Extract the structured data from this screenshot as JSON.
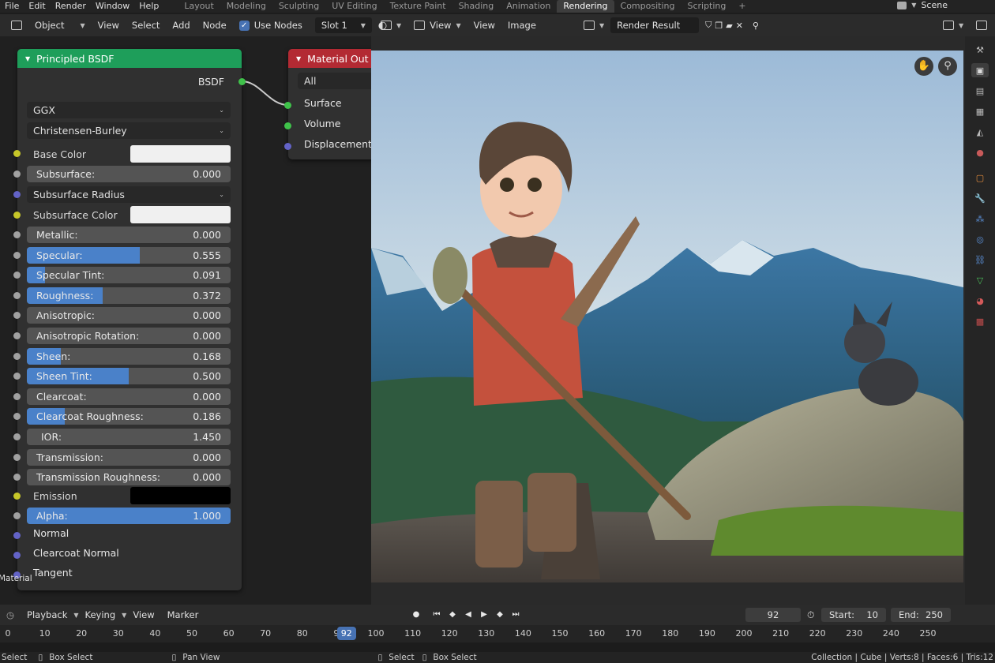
{
  "topbar": {
    "menu": [
      "File",
      "Edit",
      "Render",
      "Window",
      "Help"
    ],
    "workspaces": [
      "Layout",
      "Modeling",
      "Sculpting",
      "UV Editing",
      "Texture Paint",
      "Shading",
      "Animation",
      "Rendering",
      "Compositing",
      "Scripting",
      "+"
    ],
    "active_workspace": "Rendering",
    "scene": "Scene"
  },
  "node_header": {
    "mode": "Object",
    "menus": [
      "View",
      "Select",
      "Add",
      "Node"
    ],
    "use_nodes": "Use Nodes",
    "slot": "Slot 1"
  },
  "image_header": {
    "menus": [
      "View",
      "View",
      "Image"
    ],
    "image_name": "Render Result"
  },
  "bsdf_node": {
    "title": "Principled BSDF",
    "output": "BSDF",
    "distribution": "GGX",
    "subsurface_method": "Christensen-Burley",
    "base_color_label": "Base Color",
    "subsurface_label": "Subsurface:",
    "subsurface_value": "0.000",
    "subsurface_radius_label": "Subsurface Radius",
    "subsurface_color_label": "Subsurface Color",
    "sliders": [
      {
        "label": "Metallic:",
        "value": "0.000",
        "frac": 0
      },
      {
        "label": "Specular:",
        "value": "0.555",
        "frac": 0.555
      },
      {
        "label": "Specular Tint:",
        "value": "0.091",
        "frac": 0.091
      },
      {
        "label": "Roughness:",
        "value": "0.372",
        "frac": 0.372
      },
      {
        "label": "Anisotropic:",
        "value": "0.000",
        "frac": 0
      },
      {
        "label": "Anisotropic Rotation:",
        "value": "0.000",
        "frac": 0
      },
      {
        "label": "Sheen:",
        "value": "0.168",
        "frac": 0.168
      },
      {
        "label": "Sheen Tint:",
        "value": "0.500",
        "frac": 0.5
      },
      {
        "label": "Clearcoat:",
        "value": "0.000",
        "frac": 0
      },
      {
        "label": "Clearcoat Roughness:",
        "value": "0.186",
        "frac": 0.186
      },
      {
        "label": "IOR:",
        "value": "1.450",
        "frac": 0
      },
      {
        "label": "Transmission:",
        "value": "0.000",
        "frac": 0
      },
      {
        "label": "Transmission Roughness:",
        "value": "0.000",
        "frac": 0
      }
    ],
    "emission_label": "Emission",
    "alpha_label": "Alpha:",
    "alpha_value": "1.000",
    "inputs": [
      "Normal",
      "Clearcoat Normal",
      "Tangent"
    ],
    "side_label": "Material"
  },
  "output_node": {
    "title": "Material Out",
    "target": "All",
    "inputs": [
      "Surface",
      "Volume",
      "Displacement"
    ]
  },
  "colors": {
    "bsdf_header": "#1e9e5a",
    "output_header": "#b32a33",
    "slider_fill": "#4a81c9",
    "base_color": "#f0f0f0",
    "subsurface_color": "#f0f0f0",
    "emission_color": "#000000"
  },
  "timeline": {
    "menus": [
      "Playback",
      "Keying",
      "View",
      "Marker"
    ],
    "current_frame": "92",
    "start_label": "Start:",
    "start": "10",
    "end_label": "End:",
    "end": "250",
    "ticks": [
      "0",
      "10",
      "20",
      "30",
      "40",
      "50",
      "60",
      "70",
      "80",
      "90",
      "100",
      "110",
      "120",
      "130",
      "140",
      "150",
      "160",
      "170",
      "180",
      "190",
      "200",
      "210",
      "220",
      "230",
      "240",
      "250"
    ]
  },
  "status": {
    "left": [
      "Select",
      "Box Select",
      "Pan View"
    ],
    "mid": [
      "Select",
      "Box Select"
    ],
    "right": "Collection | Cube | Verts:8 | Faces:6 | Tris:12"
  }
}
